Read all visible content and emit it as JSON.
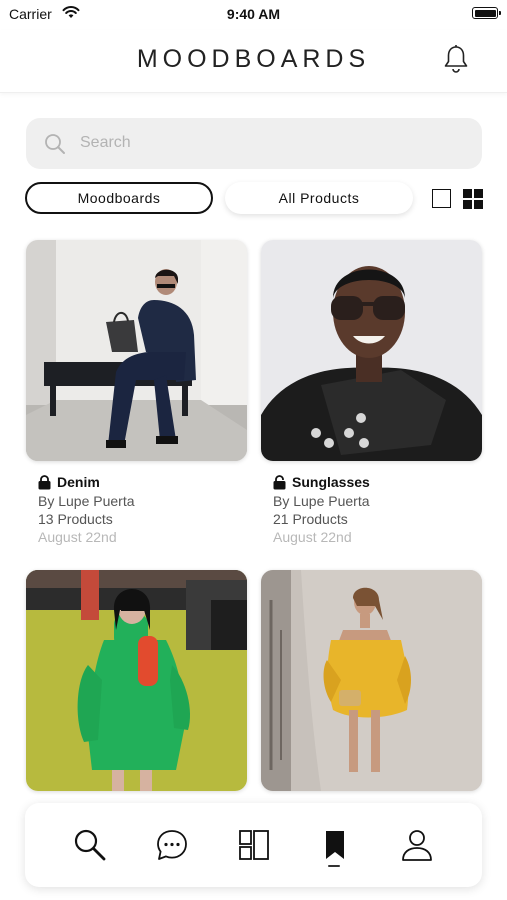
{
  "status": {
    "carrier": "Carrier",
    "time": "9:40 AM"
  },
  "header": {
    "title": "MOODBOARDS",
    "bell_icon": "bell-icon"
  },
  "search": {
    "placeholder": "Search",
    "icon": "search-icon"
  },
  "segments": {
    "moodboards": "Moodboards",
    "all_products": "All Products",
    "selected": "Moodboards"
  },
  "view_toggle": {
    "single": "single-view-icon",
    "grid": "grid-view-icon",
    "selected": "grid"
  },
  "boards": [
    {
      "title": "Denim",
      "author": "By Lupe Puerta",
      "count": "13 Products",
      "date": "August 22nd",
      "lock": "locked"
    },
    {
      "title": "Sunglasses",
      "author": "By Lupe Puerta",
      "count": "21 Products",
      "date": "August 22nd",
      "lock": "unlocked"
    },
    {
      "title": "",
      "author": "",
      "count": "",
      "date": "",
      "lock": ""
    },
    {
      "title": "",
      "author": "",
      "count": "",
      "date": "",
      "lock": ""
    }
  ],
  "tab_bar": {
    "items": [
      "search-icon",
      "chat-icon",
      "layout-icon",
      "bookmark-icon",
      "profile-icon"
    ],
    "active": "bookmark-icon"
  },
  "colors": {
    "text": "#111111",
    "muted": "#555555",
    "date": "#b8b8b8",
    "search_bg": "#efefef",
    "accent": "#1a1a1a"
  }
}
